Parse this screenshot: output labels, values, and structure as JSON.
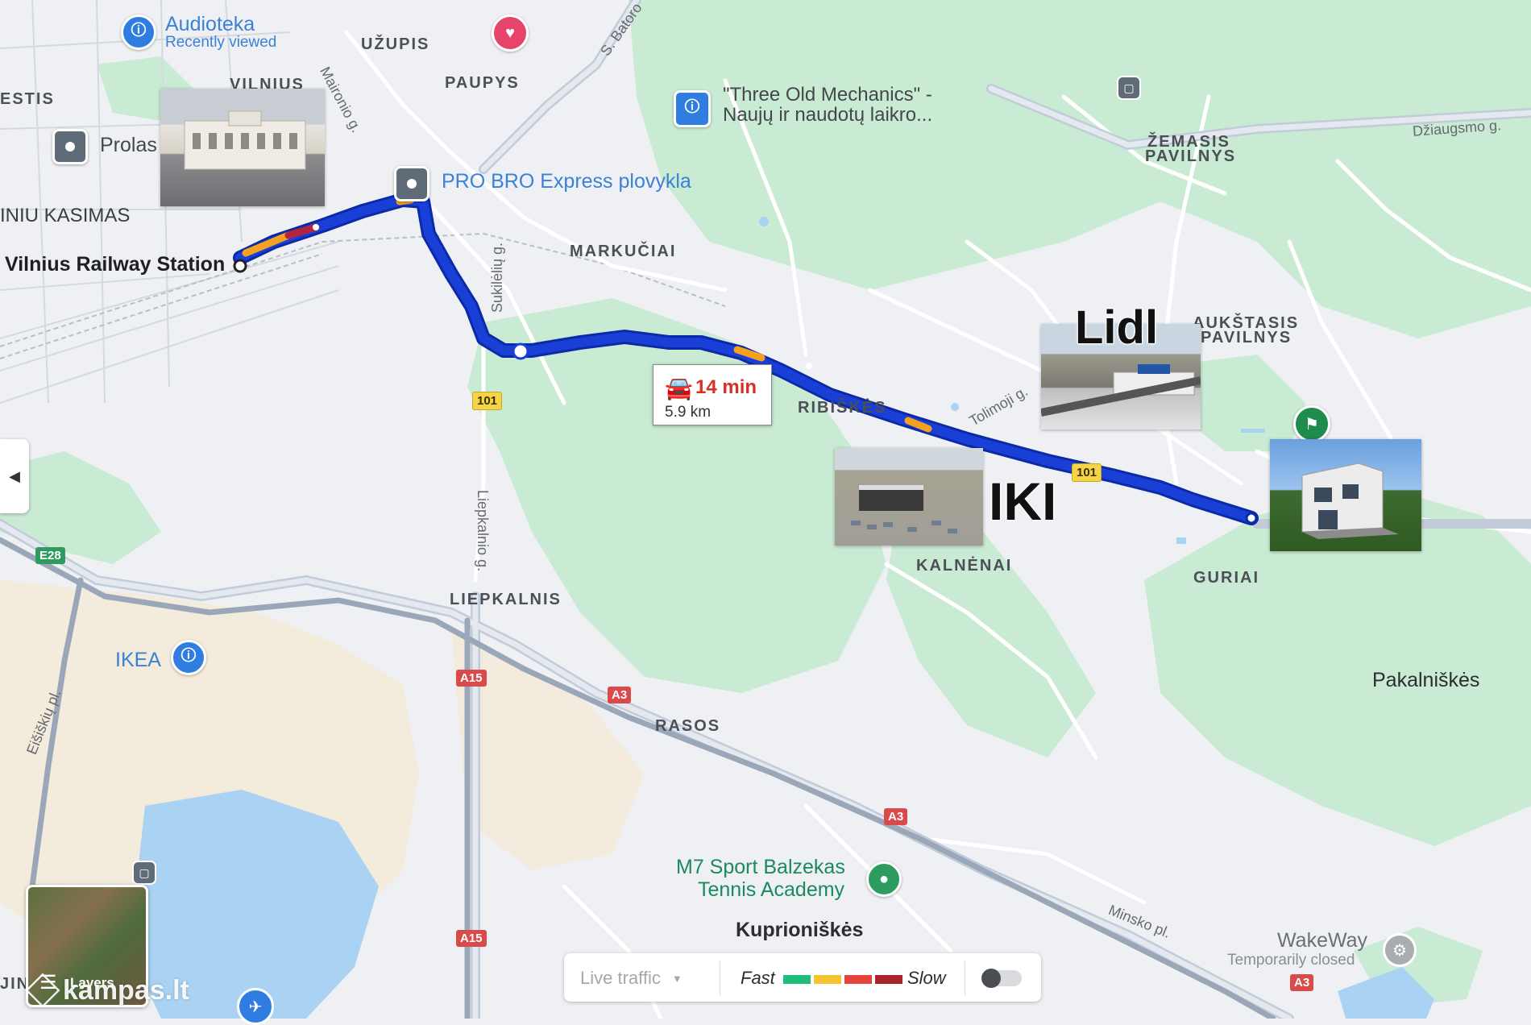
{
  "map": {
    "areas": {
      "vilnius": "VILNIUS",
      "uzupis": "UŽUPIS",
      "paupys": "PAUPYS",
      "markuciai": "MARKUČIAI",
      "zemasis_pavilnys_1": "ŽEMASIS",
      "zemasis_pavilnys_2": "PAVILNYS",
      "aukstasis_pavilnys_1": "AUKŠTASIS",
      "aukstasis_pavilnys_2": "PAVILNYS",
      "ribiskes": "RIBIŠKĖS",
      "kalnenai": "KALNĖNAI",
      "guriai": "GURIAI",
      "liepkalnis": "LIEPKALNIS",
      "rasos": "RASOS",
      "estis": "ESTIS",
      "iniu_kasimas": "INIU KASIMAS",
      "jin": "JIN"
    },
    "places": {
      "pakalniskes": "Pakalniškės",
      "kuprioniskes": "Kuprioniškės",
      "railway_station": "Vilnius Railway Station",
      "prolas": "Prolas"
    },
    "streets": {
      "maironio": "Maironio g.",
      "s_batoro": "S. Batoro",
      "dziaugsmo": "Džiaugsmo g.",
      "sukileliu": "Sukilėlių g.",
      "liepkalnio": "Liepkalnio g.",
      "tolimoji": "Tolimoji g.",
      "eisiskiu": "Eišiškių pl.",
      "minsko": "Minsko pl."
    },
    "poi": {
      "audioteka": "Audioteka",
      "audioteka_sub": "Recently viewed",
      "three_old_1": "\"Three Old Mechanics\" -",
      "three_old_2": "Naujų ir naudotų laikro...",
      "probro": "PRO BRO Express plovykla",
      "ikea": "IKEA",
      "m7_1": "M7 Sport Balzekas",
      "m7_2": "Tennis Academy",
      "wakeway": "WakeWay",
      "wakeway_sub": "Temporarily closed"
    },
    "shields": {
      "r101_a": "101",
      "r101_b": "101",
      "e28": "E28",
      "a15_a": "A15",
      "a15_b": "A15",
      "a3_a": "A3",
      "a3_b": "A3",
      "a3_c": "A3"
    },
    "stores": {
      "lidl": "Lidl",
      "iki": "IKI"
    }
  },
  "route": {
    "time": "14 min",
    "distance": "5.9 km",
    "mode_icon": "car-icon"
  },
  "traffic": {
    "mode_label": "Live traffic",
    "fast": "Fast",
    "slow": "Slow",
    "colors": [
      "#1fbf7a",
      "#f4c431",
      "#e6443a",
      "#a8232a"
    ],
    "toggle_on": false
  },
  "layers": {
    "label": "Layers"
  },
  "watermark": "kampas.lt",
  "colors": {
    "route": "#1a3fd6",
    "route_outline": "#0b2aa8",
    "park": "#c9ead3",
    "water": "#a9d2f3",
    "highway": "#9aa7b8"
  }
}
